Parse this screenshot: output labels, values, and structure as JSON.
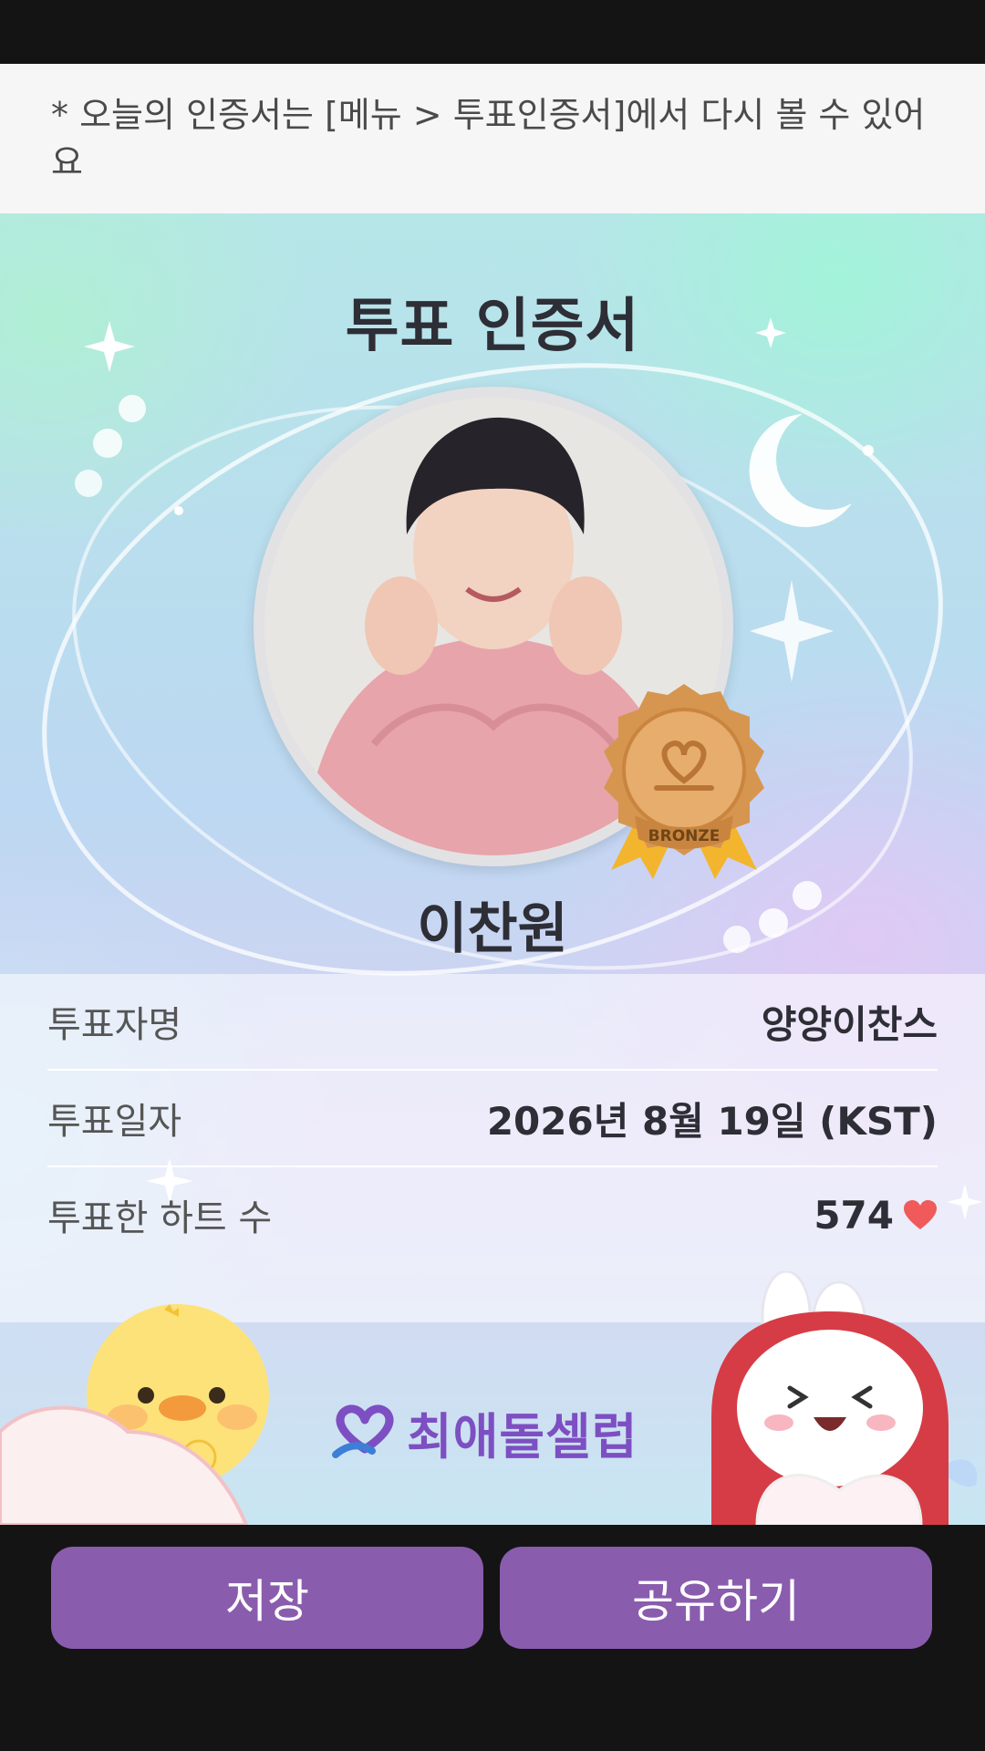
{
  "notice": {
    "text": "* 오늘의 인증서는 [메뉴 > 투표인증서]에서 다시 볼 수 있어요"
  },
  "certificate": {
    "title": "투표 인증서",
    "idol_name": "이찬원",
    "badge_label": "BRONZE",
    "rows": [
      {
        "label": "투표자명",
        "value": "양양이찬스"
      },
      {
        "label": "투표일자",
        "value": "2026년 8월 19일 (KST)"
      },
      {
        "label": "투표한 하트 수",
        "value": "574"
      }
    ],
    "brand_name": "최애돌셀럽"
  },
  "buttons": {
    "save": "저장",
    "share": "공유하기"
  },
  "colors": {
    "button": "#8a5cad",
    "heart": "#f05a5a",
    "badge": "#d9a064",
    "brand": "#7d4fc2"
  },
  "icons": [
    "heart-icon",
    "bronze-medal-icon",
    "brand-logo-icon",
    "moon-icon",
    "sparkle-icon"
  ]
}
